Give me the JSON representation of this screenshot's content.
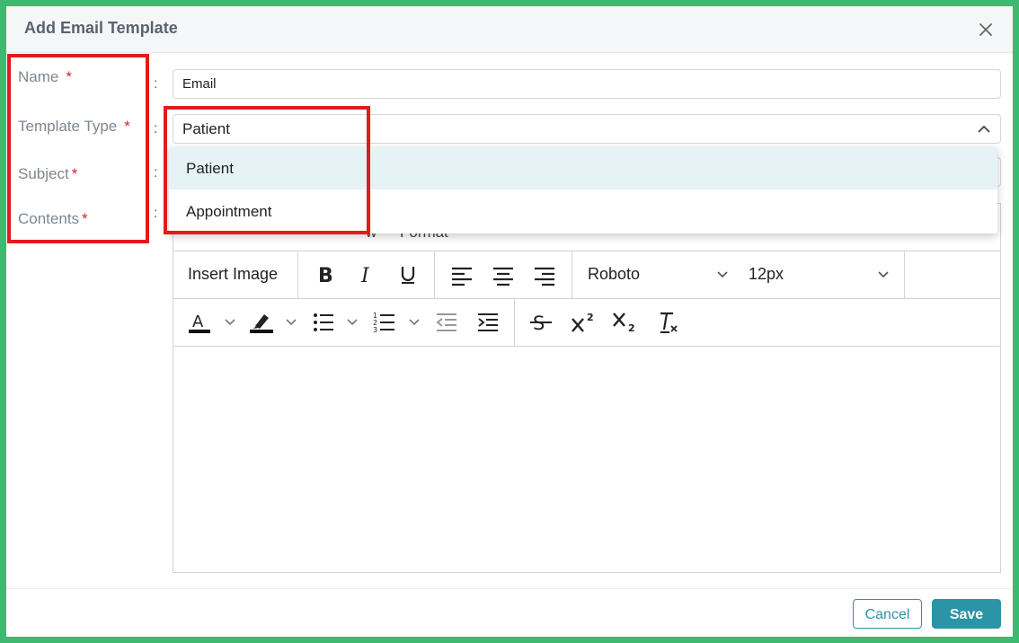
{
  "dialog": {
    "title": "Add Email Template",
    "close_icon": "close-icon"
  },
  "form": {
    "name": {
      "label": "Name",
      "required_mark": "*",
      "value": "Email"
    },
    "template_type": {
      "label": "Template Type",
      "required_mark": "*",
      "value": "Patient",
      "options": [
        "Patient",
        "Appointment"
      ]
    },
    "subject": {
      "label": "Subject",
      "required_mark": "*"
    },
    "contents": {
      "label": "Contents",
      "required_mark": "*"
    },
    "colon": ":"
  },
  "editor": {
    "menu": [
      "w",
      "Format"
    ],
    "toolbar": {
      "insert_image": "Insert Image",
      "font_family": "Roboto",
      "font_size": "12px",
      "icons": [
        "bold-icon",
        "italic-icon",
        "underline-icon",
        "align-left-icon",
        "align-center-icon",
        "align-right-icon",
        "font-color-icon",
        "highlight-icon",
        "bullet-list-icon",
        "numbered-list-icon",
        "outdent-icon",
        "indent-icon",
        "strikethrough-icon",
        "superscript-icon",
        "subscript-icon",
        "clear-format-icon"
      ]
    }
  },
  "footer": {
    "cancel_label": "Cancel",
    "save_label": "Save"
  },
  "colors": {
    "accent": "#2b94a6",
    "required": "#d3242c",
    "annotation": "#e21b1b",
    "selected_option": "#e5f3f6"
  }
}
